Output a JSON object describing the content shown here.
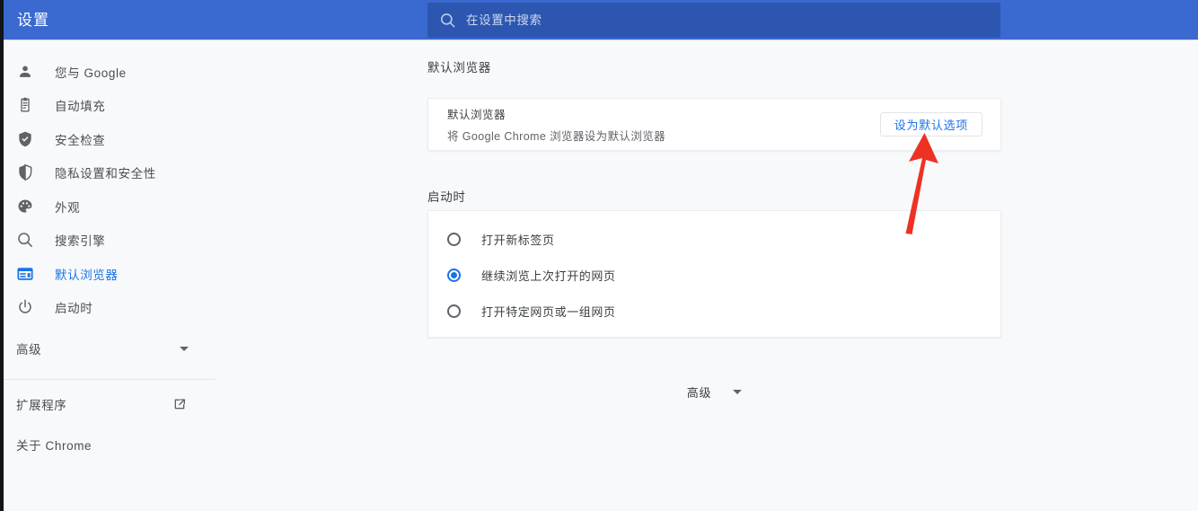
{
  "header": {
    "title": "设置",
    "search_placeholder": "在设置中搜索",
    "search_value": "",
    "search_icon": "search-icon",
    "bg_color": "#3a69cf",
    "search_bg_color": "#2d56b0"
  },
  "sidebar": {
    "items": [
      {
        "label": "您与 Google",
        "icon": "person-icon",
        "active": false
      },
      {
        "label": "自动填充",
        "icon": "clipboard-icon",
        "active": false
      },
      {
        "label": "安全检查",
        "icon": "shield-check-icon",
        "active": false
      },
      {
        "label": "隐私设置和安全性",
        "icon": "shield-half-icon",
        "active": false
      },
      {
        "label": "外观",
        "icon": "palette-icon",
        "active": false
      },
      {
        "label": "搜索引擎",
        "icon": "magnifier-icon",
        "active": false
      },
      {
        "label": "默认浏览器",
        "icon": "browser-window-icon",
        "active": true
      },
      {
        "label": "启动时",
        "icon": "power-icon",
        "active": false
      }
    ],
    "advanced": {
      "label": "高级",
      "icon": "chevron-down-icon"
    },
    "footer": [
      {
        "label": "扩展程序",
        "icon": "external-link-icon"
      },
      {
        "label": "关于 Chrome",
        "icon": null
      }
    ],
    "active_color": "#1a73e8"
  },
  "main": {
    "default_browser": {
      "section_title": "默认浏览器",
      "row_title": "默认浏览器",
      "row_subtitle": "将 Google Chrome 浏览器设为默认浏览器",
      "button_label": "设为默认选项",
      "button_text_color": "#1a73e8"
    },
    "startup": {
      "section_title": "启动时",
      "options": [
        {
          "label": "打开新标签页",
          "selected": false
        },
        {
          "label": "继续浏览上次打开的网页",
          "selected": true
        },
        {
          "label": "打开特定网页或一组网页",
          "selected": false
        }
      ],
      "selected_color": "#1a73e8"
    },
    "advanced_expander": {
      "label": "高级",
      "icon": "chevron-down-icon"
    }
  },
  "annotation": {
    "type": "arrow",
    "color": "#ed3224",
    "points_to": "设为默认选项"
  }
}
